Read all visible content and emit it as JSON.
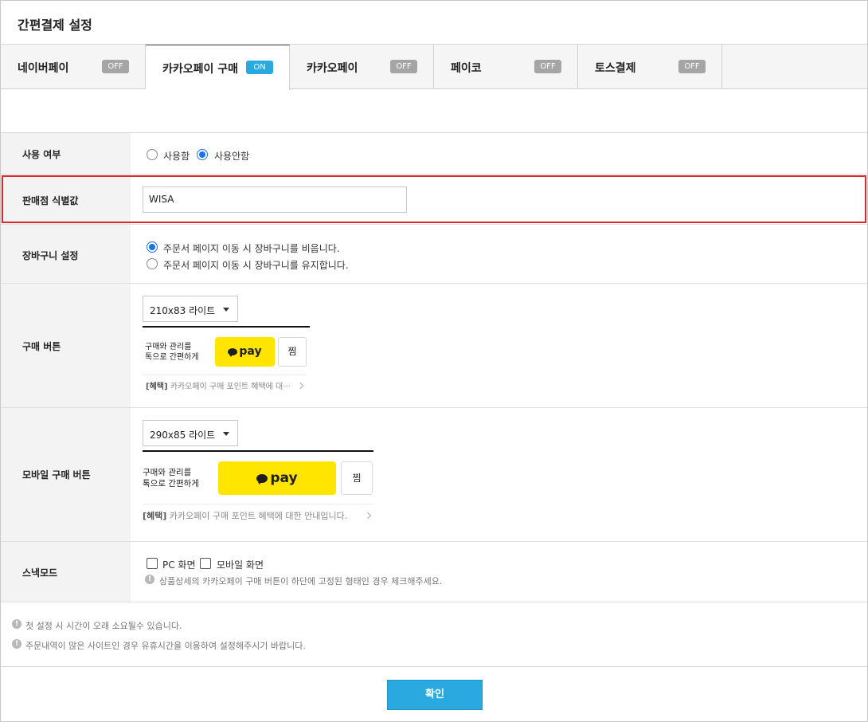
{
  "page": {
    "title": "간편결제 설정"
  },
  "tabs": [
    {
      "label": "네이버페이",
      "badge": "OFF"
    },
    {
      "label": "카카오페이 구매",
      "badge": "ON"
    },
    {
      "label": "카카오페이",
      "badge": "OFF"
    },
    {
      "label": "페이코",
      "badge": "OFF"
    },
    {
      "label": "토스결제",
      "badge": "OFF"
    }
  ],
  "active_tab": "카카오페이 구매",
  "usage": {
    "label": "사용 여부",
    "options": [
      "사용함",
      "사용안함"
    ],
    "selected": "사용안함"
  },
  "merchant_id": {
    "label": "판매점 식별값",
    "value": "WISA"
  },
  "cart": {
    "label": "장바구니 설정",
    "options": [
      "주문서 페이지 이동 시 장바구니를 비웁니다.",
      "주문서 페이지 이동 시 장바구니를 유지합니다."
    ],
    "selected": "주문서 페이지 이동 시 장바구니를 비웁니다."
  },
  "buy_button": {
    "label": "구매 버튼",
    "select_value": "210x83 라이트",
    "promo_line1": "구매와 관리를",
    "promo_line2": "톡으로 간편하게",
    "pay_text": "pay",
    "zzim": "찜",
    "benefit_tag": "[혜택]",
    "benefit_text": "카카오페이 구매 포인트 혜택에 대···"
  },
  "mobile_button": {
    "label": "모바일 구매 버튼",
    "select_value": "290x85 라이트",
    "promo_line1": "구매와 관리를",
    "promo_line2": "톡으로 간편하게",
    "pay_text": "pay",
    "zzim": "찜",
    "benefit_tag": "[혜택]",
    "benefit_text": "카카오페이 구매 포인트 혜택에 대한 안내입니다."
  },
  "snack_mode": {
    "label": "스낵모드",
    "options": [
      "PC 화면",
      "모바일 화면"
    ],
    "note": "상품상세의 카카오페이 구매 버튼이 하단에 고정된 형태인 경우 체크해주세요."
  },
  "notes": [
    "첫 설정 시 시간이 오래 소요될수 있습니다.",
    "주문내역이 많은 사이트인 경우 유휴시간을 이용하여 설정해주시기 바랍니다."
  ],
  "confirm_label": "확인",
  "colors": {
    "accent": "#2aa9e0",
    "kakao_yellow": "#ffe500",
    "highlight": "#d9292b"
  }
}
